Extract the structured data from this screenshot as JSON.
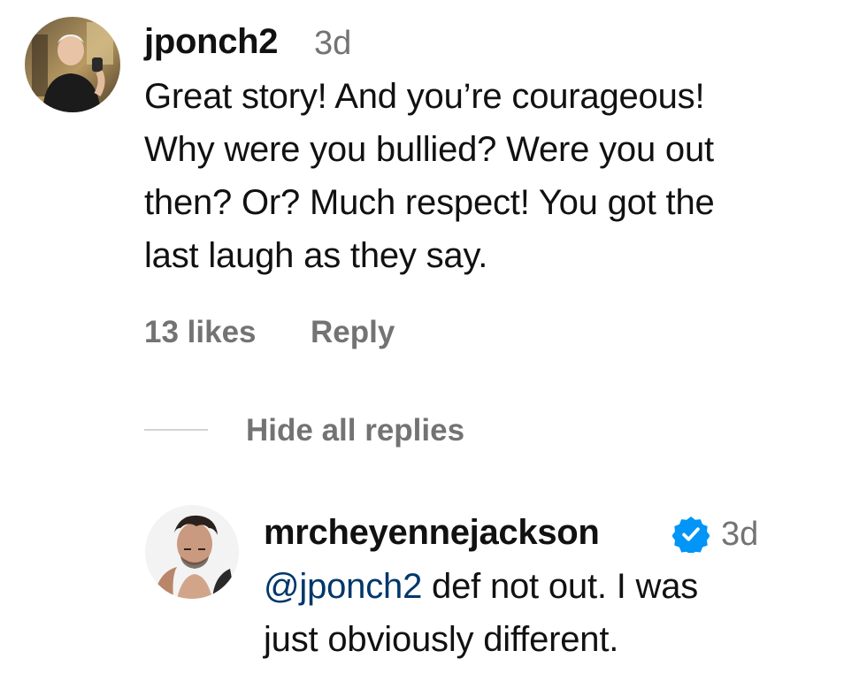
{
  "comment": {
    "username": "jponch2",
    "time": "3d",
    "text_lines": [
      "Great story! And you’re courageous!",
      "Why were you bullied? Were you out",
      "then? Or? Much respect! You got the",
      "last laugh as they say."
    ],
    "likes": "13 likes",
    "reply_label": "Reply",
    "avatar_icon": "user-photo-avatar"
  },
  "replies_toggle": {
    "label": "Hide all replies"
  },
  "reply": {
    "username": "mrcheyennejackson",
    "verified_icon": "verified-badge-icon",
    "verified_color": "#0095f6",
    "time": "3d",
    "mention": "@jponch2",
    "text_after_mention": " def not out. I was",
    "text_line2": "just obviously different.",
    "mention_color": "#00376b",
    "avatar_icon": "user-photo-avatar"
  }
}
